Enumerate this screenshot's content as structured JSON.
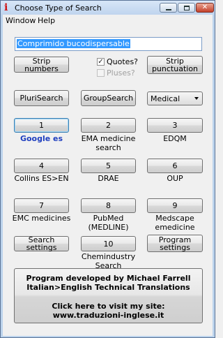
{
  "window": {
    "title": "Choose Type of Search"
  },
  "menu": [
    "Window",
    "Help"
  ],
  "search": {
    "value": "Comprimido bucodispersable"
  },
  "buttons": {
    "strip_numbers": "Strip numbers",
    "strip_punctuation_1": "Strip",
    "strip_punctuation_2": "punctuation",
    "plurisearch": "PluriSearch",
    "groupsearch": "GroupSearch",
    "search_settings": "Search settings",
    "program_settings_1": "Program",
    "program_settings_2": "settings"
  },
  "checks": {
    "quotes": {
      "label": "Quotes?",
      "checked": true
    },
    "pluses": {
      "label": "Pluses?",
      "checked": false,
      "disabled": true
    }
  },
  "category": {
    "selected": "Medical"
  },
  "slots": [
    {
      "num": "1",
      "caption1": "Google es",
      "caption2": ""
    },
    {
      "num": "2",
      "caption1": "EMA medicine",
      "caption2": "search"
    },
    {
      "num": "3",
      "caption1": "EDQM",
      "caption2": ""
    },
    {
      "num": "4",
      "caption1": "Collins ES>EN",
      "caption2": ""
    },
    {
      "num": "5",
      "caption1": "DRAE",
      "caption2": ""
    },
    {
      "num": "6",
      "caption1": "OUP",
      "caption2": ""
    },
    {
      "num": "7",
      "caption1": "EMC medicines",
      "caption2": ""
    },
    {
      "num": "8",
      "caption1": "PubMed",
      "caption2": "(MEDLINE)"
    },
    {
      "num": "9",
      "caption1": "Medscape",
      "caption2": "emedicine"
    },
    {
      "num": "10",
      "caption1": "Chemindustry",
      "caption2": "Search"
    }
  ],
  "about": {
    "line1": "Program developed by Michael Farrell",
    "line2": "Italian>English Technical Translations",
    "line3": "Click here to visit my site:",
    "line4": "www.traduzioni-inglese.it"
  },
  "colors": {
    "google_caption": "#1f3fbf",
    "selection": "#3399ff",
    "titlebar": "#bfd4ee"
  }
}
